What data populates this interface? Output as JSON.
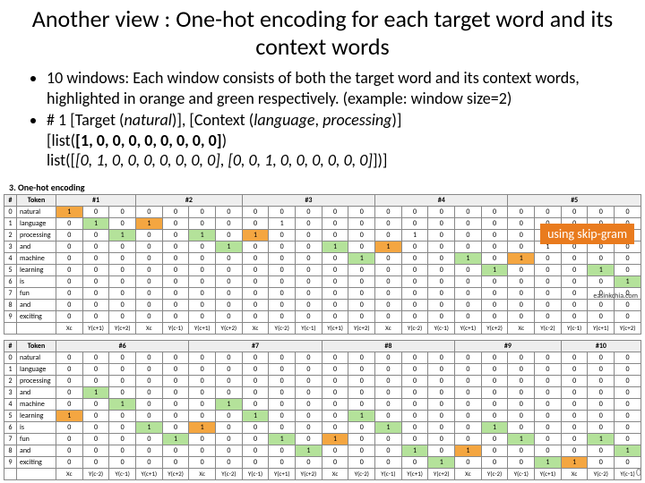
{
  "title": "Another view : One-hot encoding for each target word and its context words",
  "bullets": {
    "b1": "10 windows: Each window consists of both the target word and its context words, highlighted in orange and green respectively. (example: window size=2)",
    "b2_prefix": "# 1 [Target (",
    "b2_natural": "natural",
    "b2_mid1": ")], [Context (",
    "b2_language": "language",
    "b2_comma": ", ",
    "b2_processing": "processing",
    "b2_mid2": ")]",
    "b2_line2a": "[list(",
    "b2_line2b": "[1, 0, 0, 0, 0, 0, 0, 0, 0]",
    "b2_line2c": ")",
    "b2_line3a": " list([",
    "b2_line3b": "[0, 1, 0, 0, 0, 0, 0, 0, 0]",
    "b2_line3c": ", ",
    "b2_line3d": "[0, 0, 1, 0, 0, 0, 0, 0, 0]",
    "b2_line3e": "])]"
  },
  "callout": "using skip-gram",
  "section_label": "3. One-hot encoding",
  "credit": "easinkchia.com",
  "page_num": "0",
  "tokens": [
    "natural",
    "language",
    "processing",
    "and",
    "machine",
    "learning",
    "is",
    "fun",
    "and",
    "exciting"
  ],
  "row_nums": [
    "0",
    "1",
    "2",
    "3",
    "4",
    "5",
    "6",
    "7",
    "8",
    "9"
  ],
  "table1": {
    "groups": [
      "#1",
      "#2",
      "#3",
      "#4",
      "#5"
    ],
    "cols": [
      "Xc",
      "Y(c+1)",
      "Y(c+2)",
      "Xc",
      "Y(c-1)",
      "Y(c+1)",
      "Y(c+2)",
      "Xc",
      "Y(c-2)",
      "Y(c-1)",
      "Y(c+1)",
      "Y(c+2)",
      "Xc",
      "Y(c-2)",
      "Y(c-1)",
      "Y(c+1)",
      "Y(c+2)",
      "Xc",
      "Y(c-2)",
      "Y(c-1)",
      "Y(c+1)",
      "Y(c+2)"
    ],
    "highlights": {
      "0": {
        "0": "o"
      },
      "1": {
        "1": "g",
        "3": "o"
      },
      "2": {
        "2": "g",
        "5": "g",
        "7": "o"
      },
      "3": {
        "6": "g",
        "10": "g",
        "12": "o"
      },
      "4": {
        "11": "g",
        "15": "g",
        "17": "o"
      },
      "5": {
        "16": "g",
        "20": "g"
      },
      "6": {
        "21": "g"
      },
      "r_other": "0"
    },
    "matrix": [
      [
        1,
        0,
        0,
        0,
        0,
        0,
        0,
        0,
        0,
        0,
        0,
        0,
        0,
        0,
        0,
        0,
        0,
        0,
        0,
        0,
        0,
        0
      ],
      [
        0,
        1,
        0,
        1,
        0,
        0,
        0,
        0,
        1,
        0,
        0,
        0,
        0,
        0,
        0,
        0,
        0,
        0,
        0,
        0,
        0,
        0
      ],
      [
        0,
        0,
        1,
        0,
        0,
        1,
        0,
        1,
        0,
        0,
        0,
        0,
        0,
        1,
        0,
        0,
        0,
        0,
        0,
        0,
        0,
        0
      ],
      [
        0,
        0,
        0,
        0,
        0,
        0,
        1,
        0,
        0,
        0,
        1,
        0,
        1,
        0,
        0,
        0,
        0,
        0,
        1,
        0,
        0,
        0
      ],
      [
        0,
        0,
        0,
        0,
        0,
        0,
        0,
        0,
        0,
        0,
        0,
        1,
        0,
        0,
        0,
        1,
        0,
        1,
        0,
        0,
        0,
        0
      ],
      [
        0,
        0,
        0,
        0,
        0,
        0,
        0,
        0,
        0,
        0,
        0,
        0,
        0,
        0,
        0,
        0,
        1,
        0,
        0,
        0,
        1,
        0
      ],
      [
        0,
        0,
        0,
        0,
        0,
        0,
        0,
        0,
        0,
        0,
        0,
        0,
        0,
        0,
        0,
        0,
        0,
        0,
        0,
        0,
        0,
        1
      ],
      [
        0,
        0,
        0,
        0,
        0,
        0,
        0,
        0,
        0,
        0,
        0,
        0,
        0,
        0,
        0,
        0,
        0,
        0,
        0,
        0,
        0,
        0
      ],
      [
        0,
        0,
        0,
        0,
        0,
        0,
        0,
        0,
        0,
        0,
        0,
        0,
        0,
        0,
        0,
        0,
        0,
        0,
        0,
        0,
        0,
        0
      ],
      [
        0,
        0,
        0,
        0,
        0,
        0,
        0,
        0,
        0,
        0,
        0,
        0,
        0,
        0,
        0,
        0,
        0,
        0,
        0,
        0,
        0,
        0
      ]
    ]
  },
  "table2": {
    "groups": [
      "#6",
      "#7",
      "#8",
      "#9",
      "#10"
    ],
    "cols": [
      "Xc",
      "Y(c-2)",
      "Y(c-1)",
      "Y(c+1)",
      "Y(c+2)",
      "Xc",
      "Y(c-2)",
      "Y(c-1)",
      "Y(c+1)",
      "Y(c+2)",
      "Xc",
      "Y(c-2)",
      "Y(c-1)",
      "Y(c+1)",
      "Y(c+2)",
      "Xc",
      "Y(c-2)",
      "Y(c-1)",
      "Y(c+1)",
      "Xc",
      "Y(c-2)",
      "Y(c-1)"
    ],
    "highlights": {
      "3": {
        "1": "g"
      },
      "4": {
        "2": "g",
        "6": "g"
      },
      "5": {
        "0": "o",
        "7": "g",
        "11": "g"
      },
      "6": {
        "3": "g",
        "5": "o",
        "12": "g",
        "16": "g"
      },
      "7": {
        "4": "g",
        "8": "g",
        "10": "o",
        "17": "g",
        "20": "g"
      },
      "8": {
        "9": "g",
        "13": "g",
        "15": "o",
        "21": "g"
      },
      "9": {
        "14": "g",
        "18": "g",
        "19": "o"
      }
    },
    "matrix": [
      [
        0,
        0,
        0,
        0,
        0,
        0,
        0,
        0,
        0,
        0,
        0,
        0,
        0,
        0,
        0,
        0,
        0,
        0,
        0,
        0,
        0,
        0
      ],
      [
        0,
        0,
        0,
        0,
        0,
        0,
        0,
        0,
        0,
        0,
        0,
        0,
        0,
        0,
        0,
        0,
        0,
        0,
        0,
        0,
        0,
        0
      ],
      [
        0,
        0,
        0,
        0,
        0,
        0,
        0,
        0,
        0,
        0,
        0,
        0,
        0,
        0,
        0,
        0,
        0,
        0,
        0,
        0,
        0,
        0
      ],
      [
        0,
        1,
        0,
        0,
        0,
        0,
        0,
        0,
        0,
        0,
        0,
        0,
        0,
        0,
        0,
        0,
        0,
        0,
        0,
        0,
        0,
        0
      ],
      [
        0,
        0,
        1,
        0,
        0,
        0,
        1,
        0,
        0,
        0,
        0,
        0,
        0,
        0,
        0,
        0,
        0,
        0,
        0,
        0,
        0,
        0
      ],
      [
        1,
        0,
        0,
        0,
        0,
        0,
        0,
        1,
        0,
        0,
        0,
        1,
        0,
        0,
        0,
        0,
        0,
        0,
        0,
        0,
        0,
        0
      ],
      [
        0,
        0,
        0,
        1,
        0,
        1,
        0,
        0,
        0,
        0,
        0,
        0,
        1,
        0,
        0,
        0,
        1,
        0,
        0,
        0,
        0,
        0
      ],
      [
        0,
        0,
        0,
        0,
        1,
        0,
        0,
        0,
        1,
        0,
        1,
        0,
        0,
        0,
        0,
        0,
        0,
        1,
        0,
        0,
        1,
        0
      ],
      [
        0,
        0,
        0,
        0,
        0,
        0,
        0,
        0,
        0,
        1,
        0,
        0,
        0,
        1,
        0,
        1,
        0,
        0,
        0,
        0,
        0,
        1
      ],
      [
        0,
        0,
        0,
        0,
        0,
        0,
        0,
        0,
        0,
        0,
        0,
        0,
        0,
        0,
        1,
        0,
        0,
        0,
        1,
        1,
        0,
        0
      ]
    ]
  },
  "hdr_num": "#",
  "hdr_token": "Token"
}
